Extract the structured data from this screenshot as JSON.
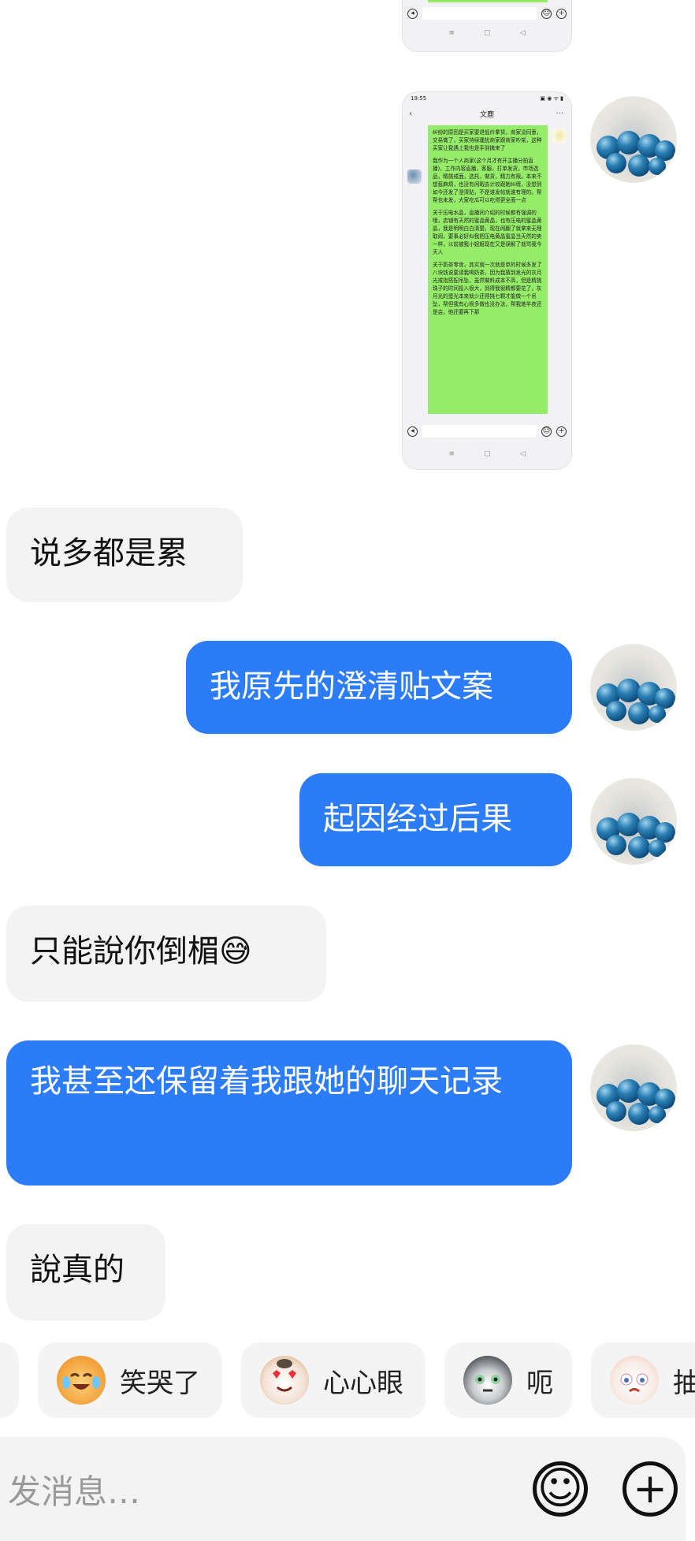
{
  "screenshot_top": {
    "input_icon_left": "voice-icon",
    "input_icon_emoji": "☺",
    "input_icon_add": "+",
    "nav_buttons": [
      "≡",
      "▢",
      "◁"
    ]
  },
  "screenshot_main": {
    "status_time": "19:55",
    "status_right": "▣ ◉ ᯤ ▮",
    "title": "文鹿",
    "back": "‹",
    "more": "···",
    "paragraphs": [
      "纠纷的原因是买家要退低价拿货，商家没同意，交易做了，买家持续骚扰商家跟商家吵架，这种买家让我遇上我也是手到擒来了",
      "我作为一个人商家(这个月才有开主播分拍直播)，工作内容直播，客服，打单发货，市场选品，精挑戒面，选托，做货，精力有限。本来不想惹麻烦，也没有闲暇去计较跟她纠缠，没想到如今还发了澄清贴，不是谁发帖就谁有理的。帮帮也未发，大家吃瓜可以吃得更全面一点",
      "关于压电水晶，直播间介绍的时候都有强调的哦，店铺有天然的蜜晶黄晶，也有压电的蜜晶黄晶，我是明明白白清楚，现在闹翻了就拿来无理取闹，要事必好似我把压电黄晶蜜晶当天然的卖一样，以前被我小姐姐现在又是误解了就骂我今天人",
      "关于奶茶零食，其实就一次就是单的时候多发了八块钱说要请我喝奶茶，因为我猜到发光的灰月光戒指搭配吊坠，虽然做料成本不高，但是精挑珠子的时间投入很大，到得我很精都要花了，灰月光的蛋光本来就少还得挑七颗才能做一个吊坠，帮但我有心很多做也没办法，帮我她半夜还是会，他还要再下那"
    ],
    "input_icon_left": "voice-icon",
    "input_icon_emoji": "☺",
    "input_icon_add": "+",
    "nav_buttons": [
      "≡",
      "▢",
      "◁"
    ]
  },
  "messages": [
    {
      "side": "left",
      "text": "说多都是累"
    },
    {
      "side": "right",
      "text": "我原先的澄清贴文案"
    },
    {
      "side": "right",
      "text": "起因经过后果"
    },
    {
      "side": "left",
      "text": "只能說你倒楣😅"
    },
    {
      "side": "right",
      "text": "我甚至还保留着我跟她的聊天记录"
    },
    {
      "side": "left",
      "text": "說真的"
    }
  ],
  "emoji_bar": [
    {
      "label": "笑哭了",
      "icon": "laughing-crying-cat-icon"
    },
    {
      "label": "心心眼",
      "icon": "heart-eyes-cat-icon"
    },
    {
      "label": "呃",
      "icon": "awkward-cat-icon"
    },
    {
      "label": "抽",
      "icon": "sobbing-cat-icon"
    }
  ],
  "composer": {
    "placeholder": "发消息…",
    "emoji_icon": "☺",
    "add_icon": "+"
  },
  "colors": {
    "bubble_right": "#2b7cf6",
    "bubble_left": "#f3f3f3",
    "wechat_green": "#95ec69"
  }
}
